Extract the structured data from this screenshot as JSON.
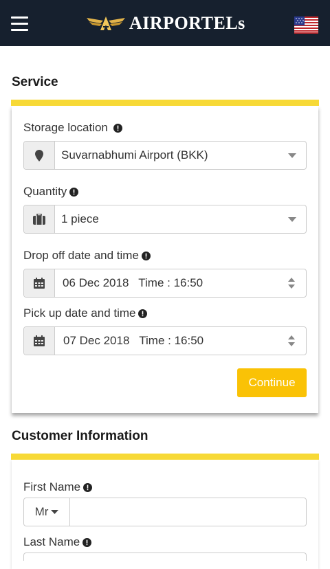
{
  "header": {
    "brand": "AIRPORTELs",
    "menu_icon": "hamburger-menu-icon",
    "flag_icon": "us-flag-icon"
  },
  "service": {
    "title": "Service",
    "storage": {
      "label": "Storage location",
      "value": "Suvarnabhumi Airport (BKK)",
      "icon": "map-pin-icon"
    },
    "quantity": {
      "label": "Quantity",
      "value": "1 piece",
      "icon": "luggage-icon"
    },
    "dropoff": {
      "label": "Drop off date and time",
      "value": "06 Dec 2018   Time : 16:50",
      "icon": "calendar-icon"
    },
    "pickup": {
      "label": "Pick up date and time",
      "value": "07 Dec 2018   Time : 16:50",
      "icon": "calendar-icon"
    },
    "continue_label": "Continue"
  },
  "customer": {
    "title": "Customer Information",
    "first_name_label": "First Name",
    "title_value": "Mr",
    "last_name_label": "Last Name"
  },
  "colors": {
    "header_bg": "#16202e",
    "accent_yellow": "#f7d936",
    "button_yellow": "#fac206"
  }
}
